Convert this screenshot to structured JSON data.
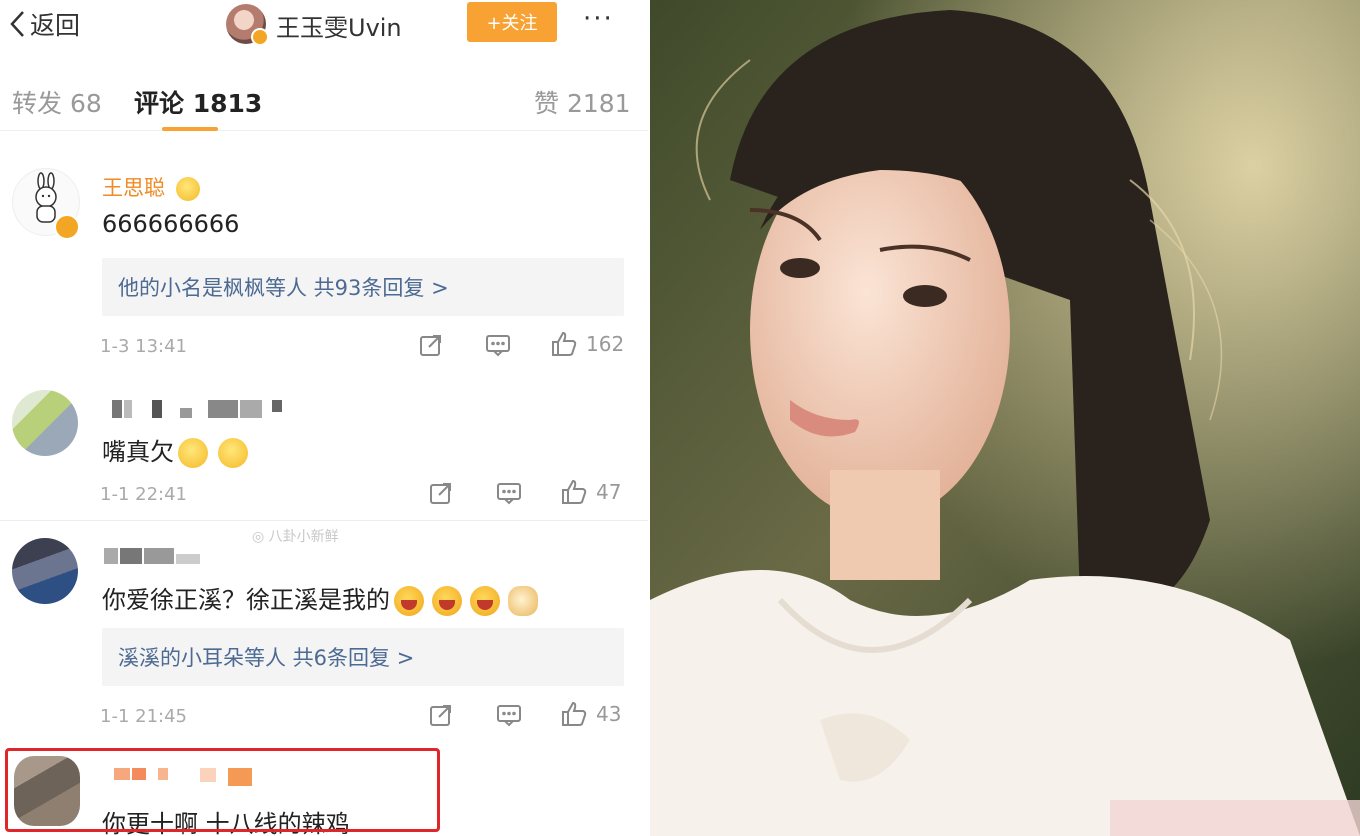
{
  "header": {
    "back_label": "返回",
    "title": "王玉雯Uvin",
    "follow_label": "+关注",
    "more_label": "···"
  },
  "tabs": [
    {
      "label": "转发 68"
    },
    {
      "label": "评论 1813"
    },
    {
      "label": "赞 2181"
    }
  ],
  "comments": [
    {
      "name": "王思聪",
      "text": "666666666",
      "replies": "他的小名是枫枫等人 共93条回复 >",
      "time": "1-3 13:41",
      "likes": "162"
    },
    {
      "name": "",
      "text": "嘴真欠",
      "time": "1-1 22:41",
      "likes": "47"
    },
    {
      "name": "",
      "text": "你爱徐正溪？徐正溪是我的",
      "replies": "溪溪的小耳朵等人 共6条回复 >",
      "time": "1-1 21:45",
      "likes": "43"
    },
    {
      "name": "",
      "text": "你更十啊 十八线的辣鸡"
    }
  ],
  "colors": {
    "accent": "#f7a233",
    "link": "#4d6a93",
    "highlight": "#e1262a"
  }
}
